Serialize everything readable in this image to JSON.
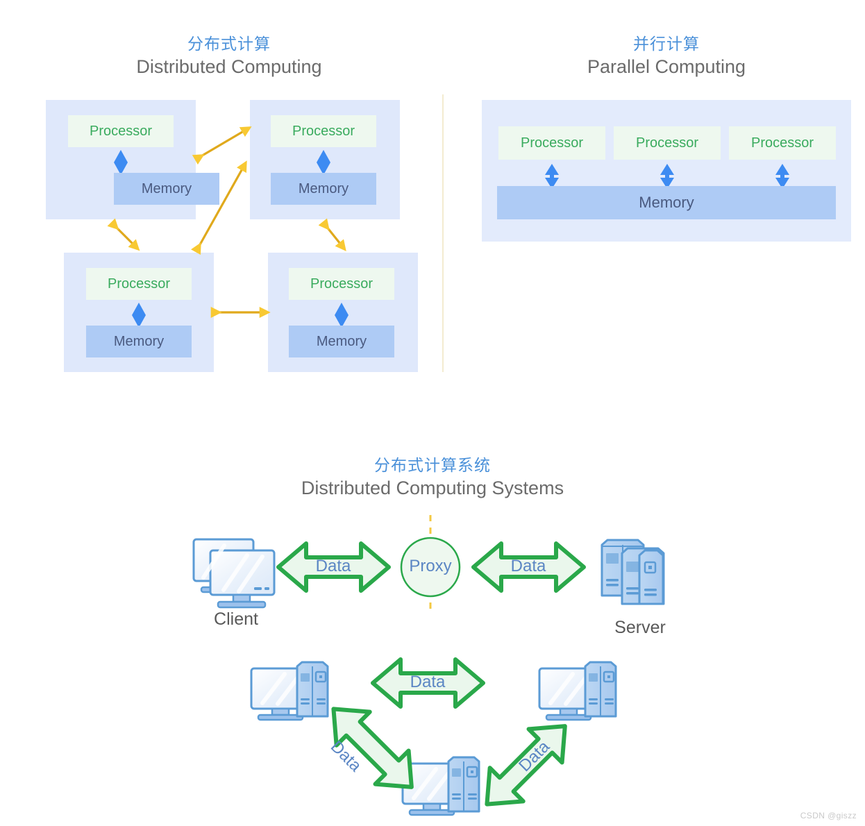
{
  "sections": {
    "distributed": {
      "title_cn": "分布式计算",
      "title_en": "Distributed Computing",
      "nodes": [
        {
          "processor": "Processor",
          "memory": "Memory"
        },
        {
          "processor": "Processor",
          "memory": "Memory"
        },
        {
          "processor": "Processor",
          "memory": "Memory"
        },
        {
          "processor": "Processor",
          "memory": "Memory"
        }
      ]
    },
    "parallel": {
      "title_cn": "并行计算",
      "title_en": "Parallel Computing",
      "processors": [
        "Processor",
        "Processor",
        "Processor"
      ],
      "memory": "Memory"
    },
    "systems": {
      "title_cn": "分布式计算系统",
      "title_en": "Distributed Computing Systems",
      "client_label": "Client",
      "server_label": "Server",
      "proxy_label": "Proxy",
      "data_labels": [
        "Data",
        "Data",
        "Data",
        "Data",
        "Data"
      ]
    }
  },
  "watermark": "CSDN @giszz",
  "colors": {
    "title_cn": "#4a90d9",
    "title_en": "#6b6b6b",
    "panel_bg": "#e3ebfc",
    "node_bg": "#dfe8fb",
    "processor_bg": "#eef8ef",
    "processor_text": "#3aab5e",
    "memory_bg": "#aecbf5",
    "memory_text": "#4a5a80",
    "diamond": "#3d8bf2",
    "arrow_yellow": "#f8c933",
    "arrow_green": "#2aa84a",
    "arrow_green_fill": "#eaf7ec",
    "divider": "#f3ecd0",
    "icon_blue": "#5b9bd5",
    "data_text": "#5b86c4"
  }
}
